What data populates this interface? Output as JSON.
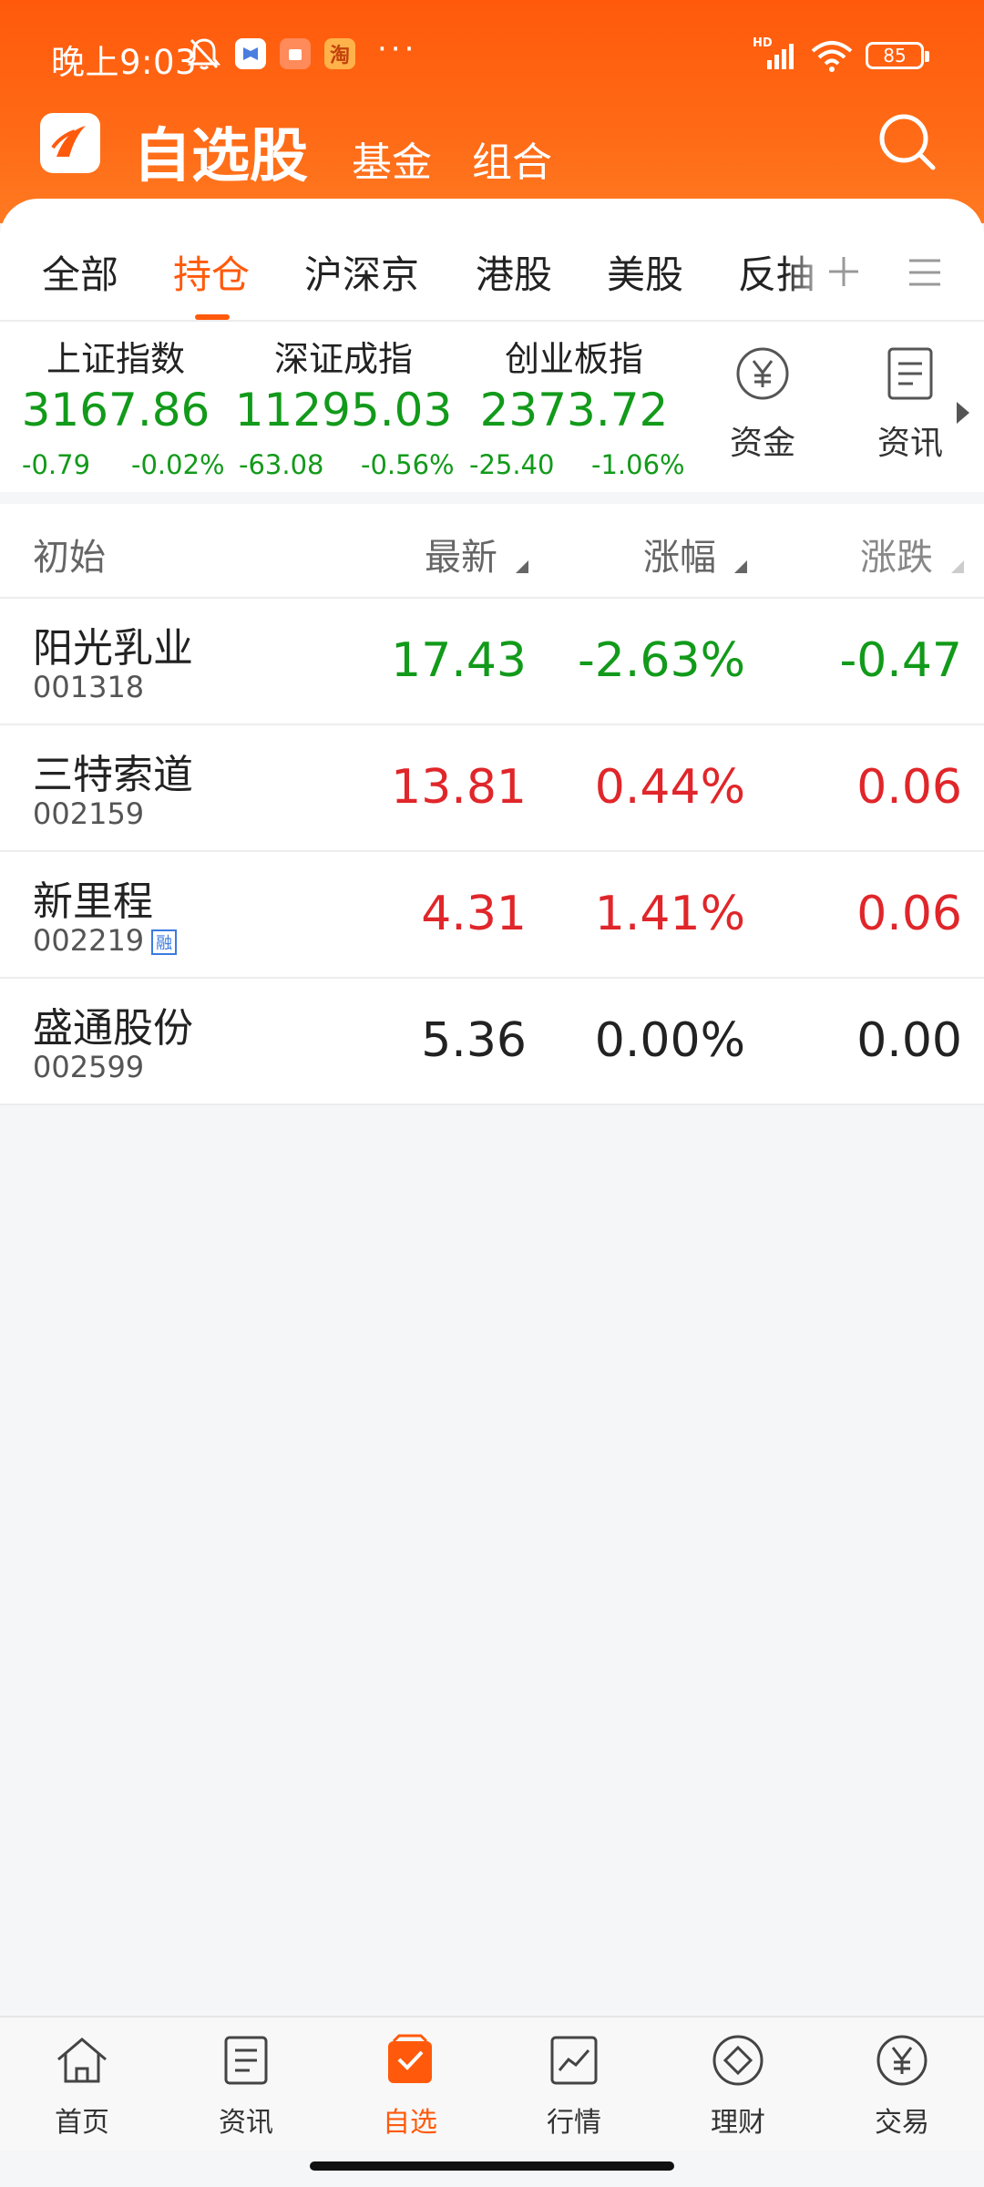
{
  "status_bar": {
    "time": "晚上9:03",
    "dots": "···",
    "network": "HD",
    "battery": "85"
  },
  "header": {
    "title": "自选股",
    "nav": [
      "基金",
      "组合"
    ]
  },
  "tabs": [
    "全部",
    "持仓",
    "沪深京",
    "港股",
    "美股",
    "反抽"
  ],
  "active_tab": "持仓",
  "indices": [
    {
      "name": "上证指数",
      "value": "3167.86",
      "change": "-0.79",
      "change_pct": "-0.02%"
    },
    {
      "name": "深证成指",
      "value": "11295.03",
      "change": "-63.08",
      "change_pct": "-0.56%"
    },
    {
      "name": "创业板指",
      "value": "2373.72",
      "change": "-25.40",
      "change_pct": "-1.06%"
    }
  ],
  "quick_links": [
    "资金",
    "资讯"
  ],
  "list_header": {
    "col1": "初始",
    "col2": "最新",
    "col3": "涨幅",
    "col4": "涨跌"
  },
  "stocks": [
    {
      "name": "阳光乳业",
      "code": "001318",
      "price": "17.43",
      "pct": "-2.63%",
      "change": "-0.47",
      "trend": "down"
    },
    {
      "name": "三特索道",
      "code": "002159",
      "price": "13.81",
      "pct": "0.44%",
      "change": "0.06",
      "trend": "up"
    },
    {
      "name": "新里程",
      "code": "002219",
      "price": "4.31",
      "pct": "1.41%",
      "change": "0.06",
      "trend": "up",
      "badge": "融"
    },
    {
      "name": "盛通股份",
      "code": "002599",
      "price": "5.36",
      "pct": "0.00%",
      "change": "0.00",
      "trend": "flat"
    }
  ],
  "colors": {
    "brand": "#ff5a0c",
    "up": "#e0262a",
    "down": "#129a1a",
    "flat": "#222222"
  },
  "bottom_nav": [
    {
      "label": "首页",
      "icon": "home-icon"
    },
    {
      "label": "资讯",
      "icon": "news-icon"
    },
    {
      "label": "自选",
      "icon": "watchlist-icon"
    },
    {
      "label": "行情",
      "icon": "market-chart-icon"
    },
    {
      "label": "理财",
      "icon": "wealth-diamond-icon"
    },
    {
      "label": "交易",
      "icon": "trade-yen-icon"
    }
  ],
  "active_nav": "自选"
}
